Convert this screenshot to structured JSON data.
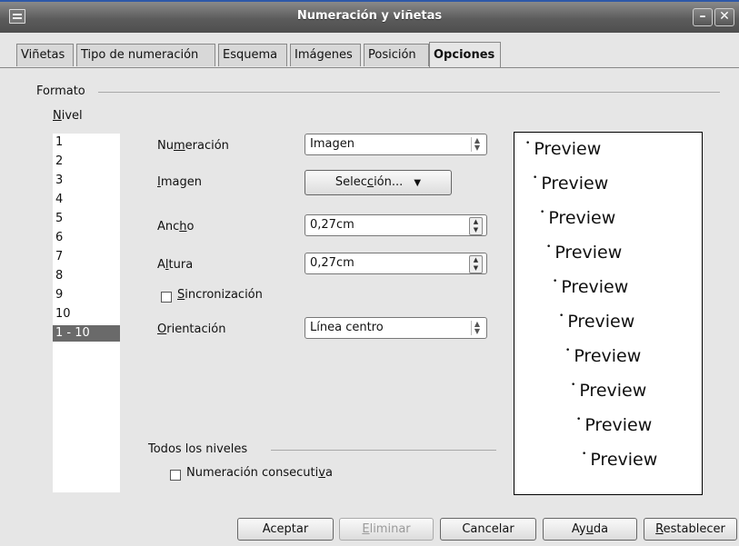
{
  "window": {
    "title": "Numeración y viñetas"
  },
  "tabs": [
    {
      "label": "Viñetas"
    },
    {
      "label": "Tipo de numeración"
    },
    {
      "label": "Esquema"
    },
    {
      "label": "Imágenes"
    },
    {
      "label": "Posición"
    },
    {
      "label": "Opciones"
    }
  ],
  "format": {
    "section_label": "Formato",
    "level_label_prefix": "N",
    "level_label_rest": "ivel",
    "levels": [
      "1",
      "2",
      "3",
      "4",
      "5",
      "6",
      "7",
      "8",
      "9",
      "10",
      "1 - 10"
    ],
    "selected_level": "1 - 10"
  },
  "options": {
    "numeracion": {
      "label_a": "Nu",
      "label_u": "m",
      "label_b": "eración",
      "value": "Imagen"
    },
    "imagen": {
      "label_u": "I",
      "label_b": "magen",
      "button_a": "Selec",
      "button_u": "c",
      "button_b": "ión..."
    },
    "ancho": {
      "label_a": "Anc",
      "label_u": "h",
      "label_b": "o",
      "value": "0,27cm"
    },
    "altura": {
      "label_a": "A",
      "label_u": "l",
      "label_b": "tura",
      "value": "0,27cm"
    },
    "sincronizacion": {
      "label_u": "S",
      "label_b": "incronización",
      "checked": false
    },
    "orientacion": {
      "label_u": "O",
      "label_b": "rientación",
      "value": "Línea centro"
    }
  },
  "all_levels": {
    "section_label": "Todos los niveles",
    "consecutive": {
      "label_a": "Numeración consecuti",
      "label_u": "v",
      "label_b": "a",
      "checked": false
    }
  },
  "preview": {
    "text": "Preview",
    "bullet": "•",
    "count": 10
  },
  "buttons": {
    "accept": "Aceptar",
    "delete_u": "E",
    "delete_b": "liminar",
    "cancel": "Cancelar",
    "help_a": "Ay",
    "help_u": "u",
    "help_b": "da",
    "reset_u": "R",
    "reset_b": "establecer"
  },
  "icons": [
    "app-icon",
    "minimize-icon",
    "close-icon",
    "chevron-down-icon",
    "spin-arrows-icon",
    "checkbox-icon",
    "bullet-icon"
  ]
}
